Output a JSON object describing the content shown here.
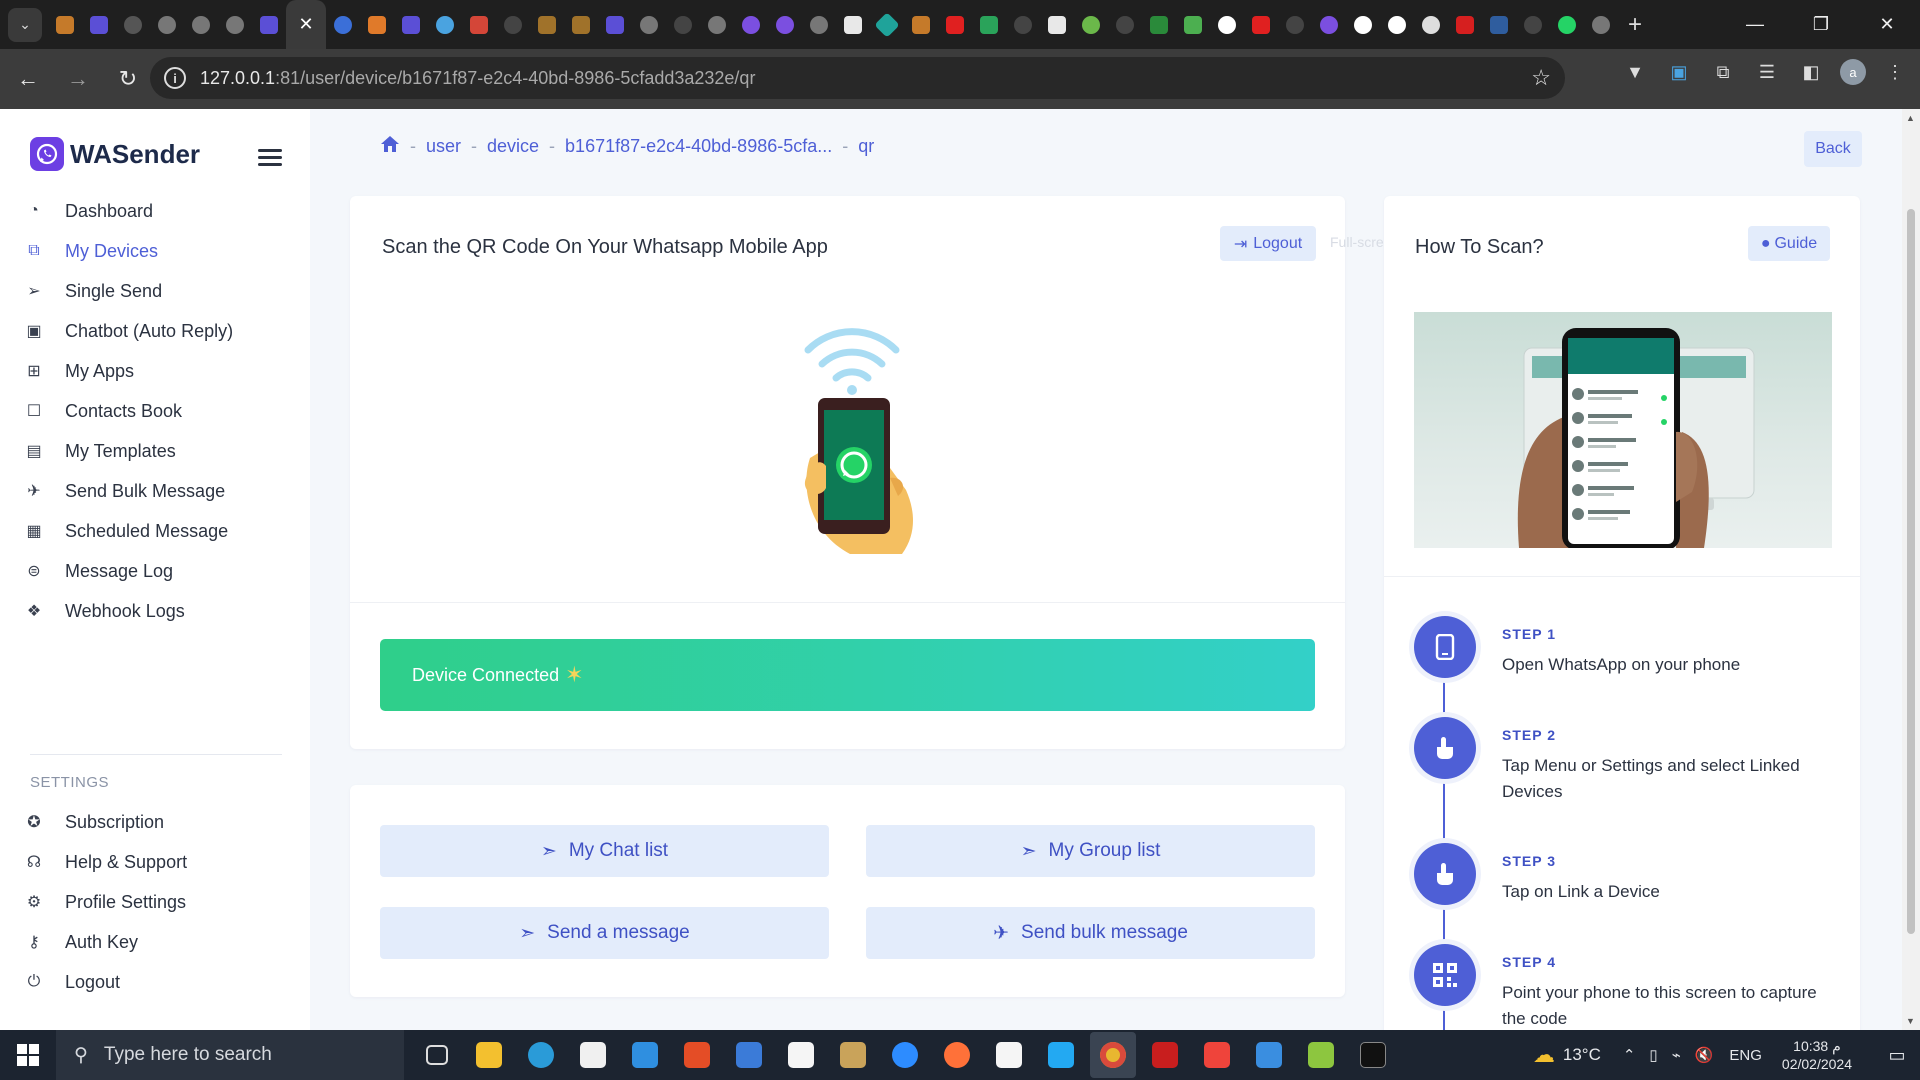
{
  "browser": {
    "url_host": "127.0.0.1",
    "url_rest": ":81/user/device/b1671f87-e2c4-40bd-8986-5cfadd3a232e/qr",
    "active_tab_close": "✕",
    "new_tab": "+",
    "profile_initial": "a"
  },
  "sidebar": {
    "brand": "WASender",
    "menu": [
      {
        "label": "Dashboard",
        "icon": "dashboard-icon",
        "active": false
      },
      {
        "label": "My Devices",
        "icon": "devices-icon",
        "active": true
      },
      {
        "label": "Single Send",
        "icon": "send-icon",
        "active": false
      },
      {
        "label": "Chatbot (Auto Reply)",
        "icon": "robot-icon",
        "active": false
      },
      {
        "label": "My Apps",
        "icon": "apps-icon",
        "active": false
      },
      {
        "label": "Contacts Book",
        "icon": "contacts-icon",
        "active": false
      },
      {
        "label": "My Templates",
        "icon": "templates-icon",
        "active": false
      },
      {
        "label": "Send Bulk Message",
        "icon": "rocket-icon",
        "active": false
      },
      {
        "label": "Scheduled Message",
        "icon": "calendar-icon",
        "active": false
      },
      {
        "label": "Message Log",
        "icon": "log-icon",
        "active": false
      },
      {
        "label": "Webhook Logs",
        "icon": "webhook-icon",
        "active": false
      }
    ],
    "settings_title": "SETTINGS",
    "settings": [
      {
        "label": "Subscription",
        "icon": "subscription-icon"
      },
      {
        "label": "Help & Support",
        "icon": "headset-icon"
      },
      {
        "label": "Profile Settings",
        "icon": "gear-icon"
      },
      {
        "label": "Auth Key",
        "icon": "key-icon"
      },
      {
        "label": "Logout",
        "icon": "power-icon"
      }
    ]
  },
  "breadcrumb": {
    "items": [
      "user",
      "device",
      "b1671f87-e2c4-40bd-8986-5cfa...",
      "qr"
    ],
    "back_label": "Back"
  },
  "qr_card": {
    "title": "Scan the QR Code On Your Whatsapp Mobile App",
    "logout_label": "Logout",
    "fullscreen_hint": "Full-screen",
    "status": "Device Connected"
  },
  "actions": {
    "chat_list": "My Chat list",
    "group_list": "My Group list",
    "send_message": "Send a message",
    "send_bulk": "Send bulk message"
  },
  "howto": {
    "title": "How To Scan?",
    "guide_label": "Guide",
    "steps": [
      {
        "label": "STEP 1",
        "text": "Open WhatsApp on your phone",
        "icon": "phone-icon"
      },
      {
        "label": "STEP 2",
        "text": "Tap Menu or Settings and select Linked Devices",
        "icon": "tap-icon"
      },
      {
        "label": "STEP 3",
        "text": "Tap on Link a Device",
        "icon": "tap-icon"
      },
      {
        "label": "STEP 4",
        "text": "Point your phone to this screen to capture the code",
        "icon": "qr-icon"
      }
    ]
  },
  "taskbar": {
    "search_placeholder": "Type here to search",
    "temperature": "13°C",
    "language": "ENG",
    "time": "10:38 م",
    "date": "02/02/2024"
  },
  "colors": {
    "accent": "#4e5fd6",
    "connected_from": "#2fcf8a",
    "connected_to": "#33d0c8"
  }
}
